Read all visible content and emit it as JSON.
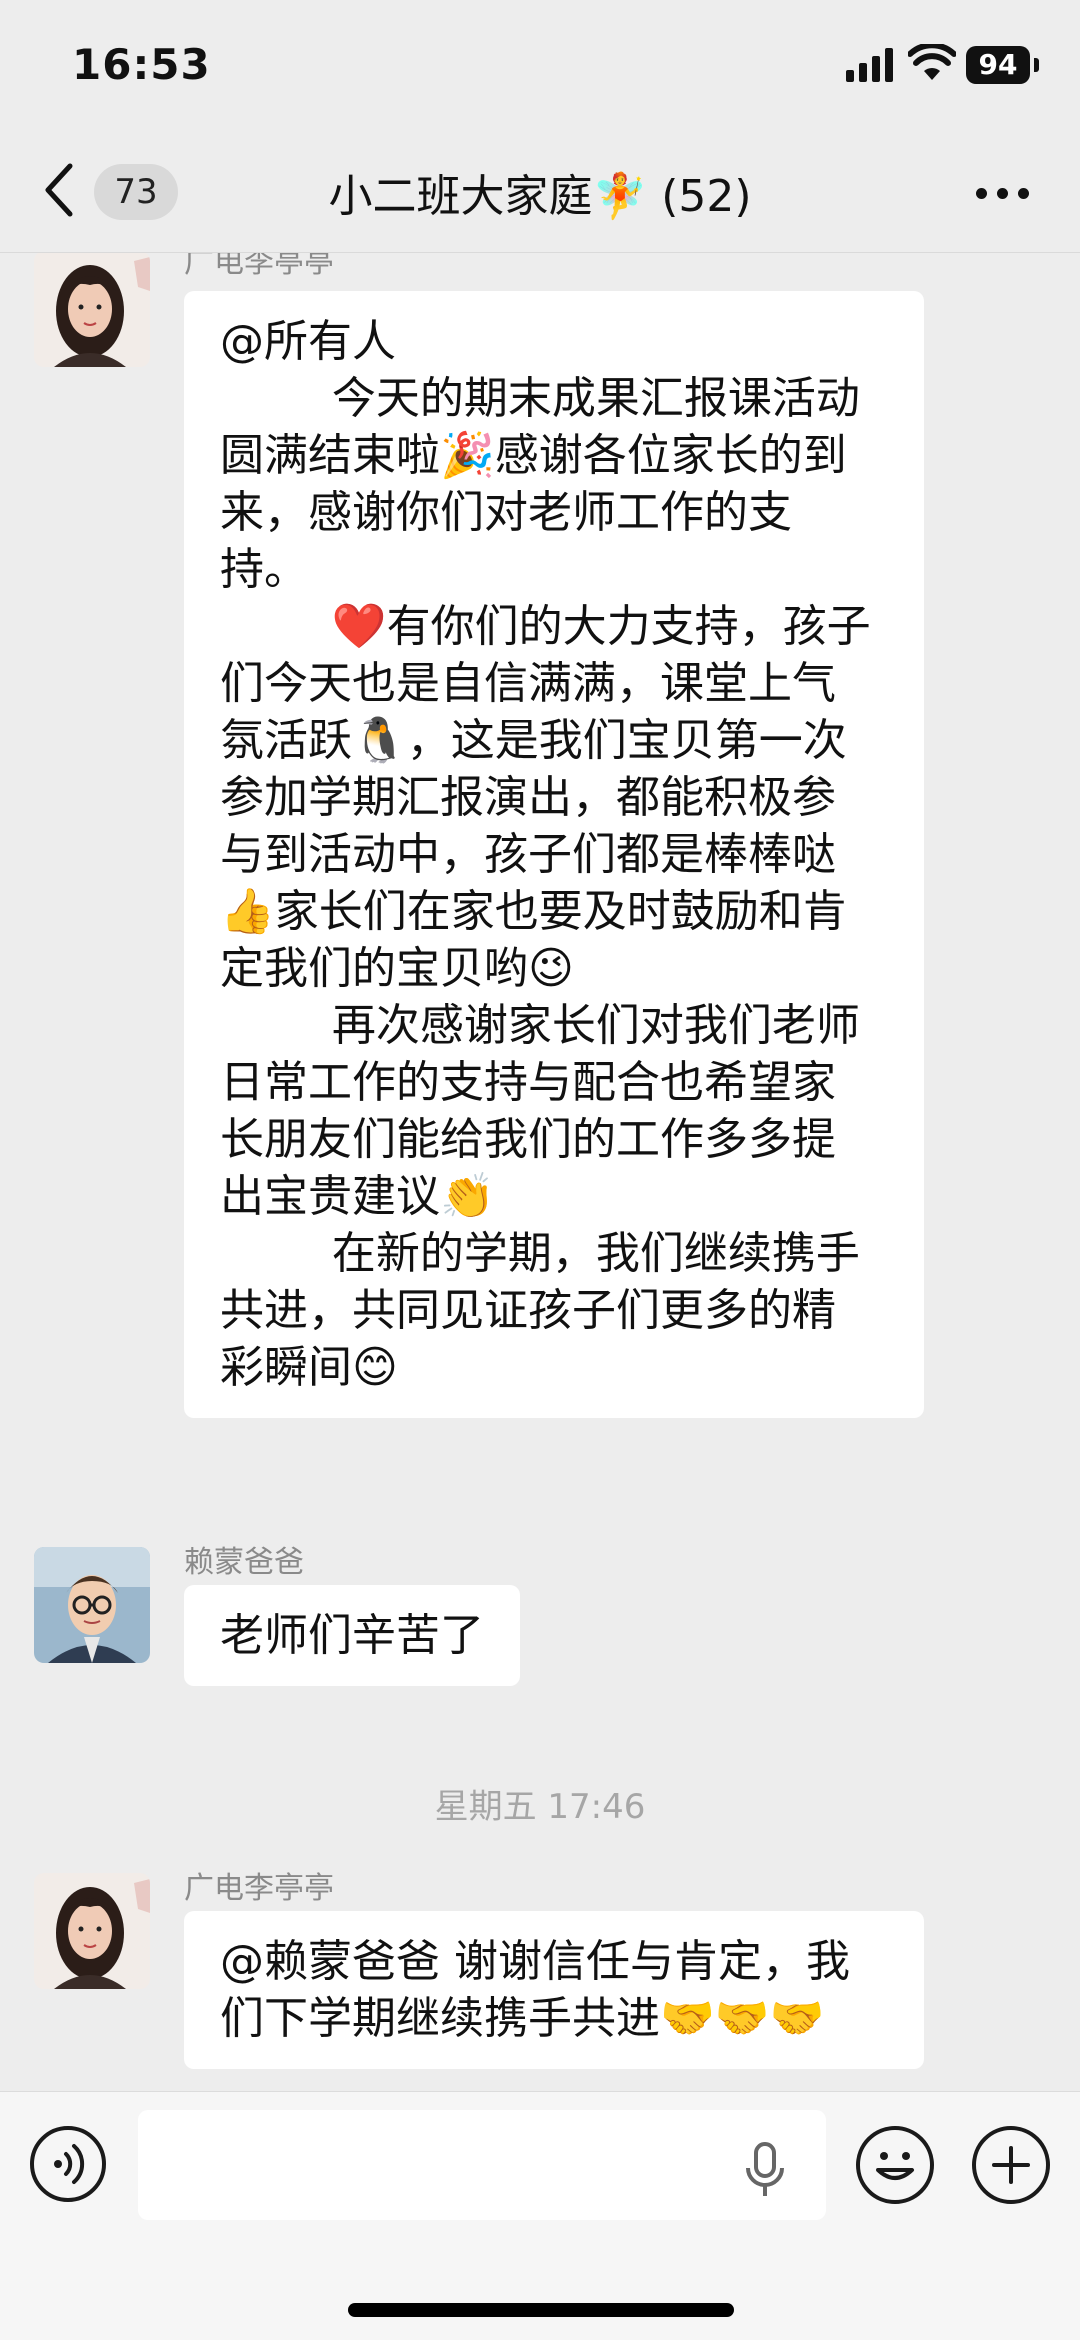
{
  "status_bar": {
    "time": "16:53",
    "battery": "94"
  },
  "nav": {
    "unread_count": "73",
    "title": "小二班大家庭🧚 (52)"
  },
  "messages": [
    {
      "sender": "广电李亭亭",
      "lines": [
        "@所有人",
        "        今天的期末成果汇报课活动",
        "圆满结束啦🎉感谢各位家长的到",
        "来，感谢你们对老师工作的支",
        "持。",
        "        ❤️有你们的大力支持，孩子",
        "们今天也是自信满满，课堂上气",
        "氛活跃🐧，这是我们宝贝第一次",
        "参加学期汇报演出，都能积极参",
        "与到活动中，孩子们都是棒棒哒",
        "👍家长们在家也要及时鼓励和肯",
        "定我们的宝贝哟😉",
        "        再次感谢家长们对我们老师",
        "日常工作的支持与配合也希望家",
        "长朋友们能给我们的工作多多提",
        "出宝贵建议👏",
        "",
        "        在新的学期，我们继续携手",
        "共进，共同见证孩子们更多的精",
        "彩瞬间😊"
      ]
    },
    {
      "sender": "赖蒙爸爸",
      "lines": [
        "老师们辛苦了"
      ]
    },
    {
      "divider": "星期五 17:46"
    },
    {
      "sender": "广电李亭亭",
      "lines": [
        "@赖蒙爸爸 谢谢信任与肯定，我",
        "们下学期继续携手共进🤝🤝🤝"
      ]
    }
  ],
  "input_bar": {
    "placeholder": ""
  },
  "icons": {
    "back": "chevron-left-icon",
    "more": "more-dots-icon",
    "voice": "voice-icon",
    "mic": "microphone-icon",
    "emoji": "emoji-smile-icon",
    "plus": "plus-icon"
  }
}
